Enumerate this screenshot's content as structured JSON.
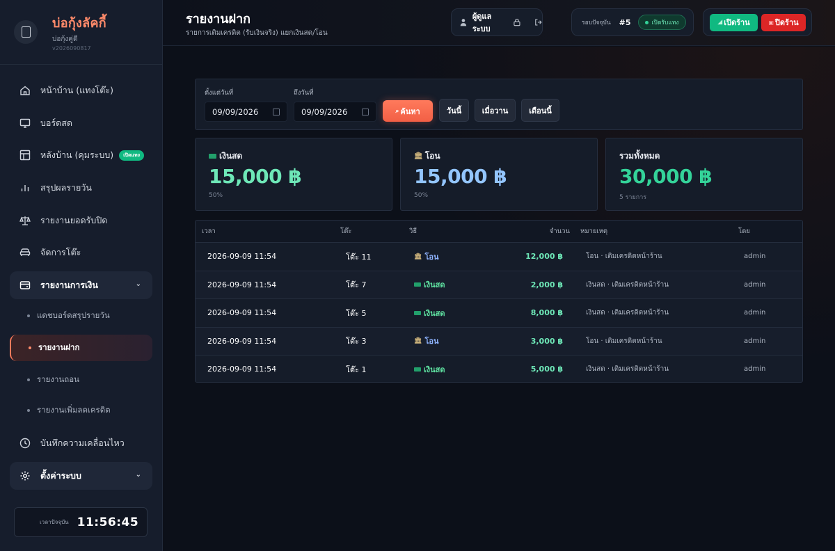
{
  "brand": {
    "name": "บ่อกุ้งลัคกี้",
    "sub": "บ่อกุ้งคู่ดี",
    "version": "v2026090817"
  },
  "sidebar": {
    "items": [
      {
        "label": "หน้าบ้าน (แทงโต๊ะ)"
      },
      {
        "label": "บอร์ดสด"
      },
      {
        "label": "หลังบ้าน (คุมระบบ)",
        "badge": "เปิดแทง"
      },
      {
        "label": "สรุปผลรายวัน"
      },
      {
        "label": "รายงานยอดรับปิด"
      },
      {
        "label": "จัดการโต๊ะ"
      }
    ],
    "finance_group": {
      "label": "รายงานการเงิน",
      "subitems": [
        {
          "label": "แดชบอร์ดสรุปรายวัน"
        },
        {
          "label": "รายงานฝาก"
        },
        {
          "label": "รายงานถอน"
        },
        {
          "label": "รายงานเพิ่มลดเครดิต"
        }
      ]
    },
    "activity_label": "บันทึกความเคลื่อนไหว",
    "settings_label": "ตั้งค่าระบบ",
    "clock": {
      "label": "เวลาปัจจุบัน",
      "time": "11:56:45"
    }
  },
  "header": {
    "title": "รายงานฝาก",
    "subtitle": "รายการเติมเครดิต (รับเงินจริง) แยกเงินสด/โอน",
    "user": "ผู้ดูแลระบบ",
    "round_label": "รอบปัจจุบัน",
    "round_number": "#5",
    "round_status": "เปิดรับแทง",
    "open_shop": "เปิดร้าน",
    "close_shop": "ปิดร้าน"
  },
  "filters": {
    "from_label": "ตั้งแต่วันที่",
    "from_value": "09/09/2026",
    "to_label": "ถึงวันที่",
    "to_value": "09/09/2026",
    "search": "ค้นหา",
    "today": "วันนี้",
    "yesterday": "เมื่อวาน",
    "this_month": "เดือนนี้"
  },
  "stats": {
    "cash": {
      "label": "เงินสด",
      "value": "15,000 ฿",
      "note": "50%",
      "color": "#6ee7b7"
    },
    "transfer": {
      "label": "โอน",
      "value": "15,000 ฿",
      "note": "50%",
      "color": "#93c5fd"
    },
    "total": {
      "label": "รวมทั้งหมด",
      "value": "30,000 ฿",
      "note": "5 รายการ",
      "color": "#34d399"
    }
  },
  "table": {
    "headers": {
      "time": "เวลา",
      "table": "โต๊ะ",
      "method": "วิธี",
      "amount": "จำนวน",
      "note": "หมายเหตุ",
      "by": "โดย"
    },
    "rows": [
      {
        "time": "2026-09-09 11:54",
        "table": "โต๊ะ 11",
        "method": "โอน",
        "amount": "12,000 ฿",
        "note": "โอน · เติมเครดิตหน้าร้าน",
        "by": "admin"
      },
      {
        "time": "2026-09-09 11:54",
        "table": "โต๊ะ 7",
        "method": "เงินสด",
        "amount": "2,000 ฿",
        "note": "เงินสด · เติมเครดิตหน้าร้าน",
        "by": "admin"
      },
      {
        "time": "2026-09-09 11:54",
        "table": "โต๊ะ 5",
        "method": "เงินสด",
        "amount": "8,000 ฿",
        "note": "เงินสด · เติมเครดิตหน้าร้าน",
        "by": "admin"
      },
      {
        "time": "2026-09-09 11:54",
        "table": "โต๊ะ 3",
        "method": "โอน",
        "amount": "3,000 ฿",
        "note": "โอน · เติมเครดิตหน้าร้าน",
        "by": "admin"
      },
      {
        "time": "2026-09-09 11:54",
        "table": "โต๊ะ 1",
        "method": "เงินสด",
        "amount": "5,000 ฿",
        "note": "เงินสด · เติมเครดิตหน้าร้าน",
        "by": "admin"
      }
    ]
  }
}
